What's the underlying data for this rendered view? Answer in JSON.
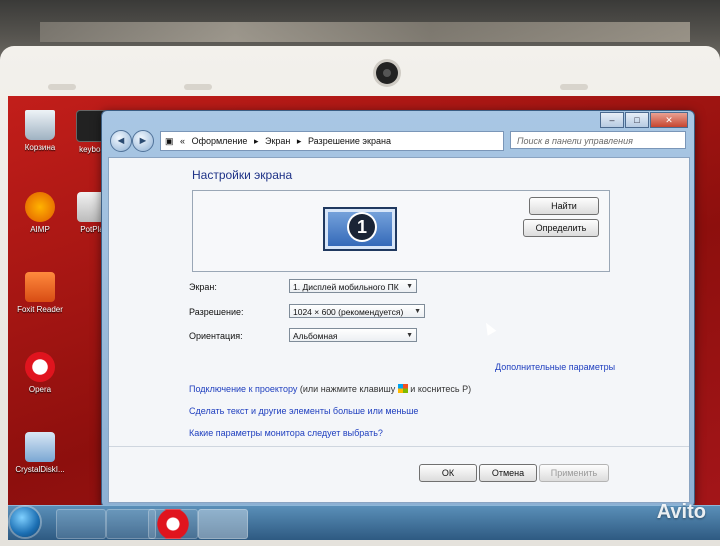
{
  "desktop": {
    "icons": [
      {
        "label": "Корзина",
        "icon": "recycle-bin-icon"
      },
      {
        "label": "keyboa",
        "icon": "keyboard-icon"
      },
      {
        "label": "AIMP",
        "icon": "aimp-icon"
      },
      {
        "label": "PotPla",
        "icon": "potplayer-icon"
      },
      {
        "label": "Foxit Reader",
        "icon": "pdf-icon"
      },
      {
        "label": "Opera",
        "icon": "opera-icon"
      },
      {
        "label": "CrystalDiskI...",
        "icon": "crystaldisk-icon"
      }
    ]
  },
  "window": {
    "controls": {
      "minimize": "–",
      "maximize": "□",
      "close": "✕"
    },
    "nav": {
      "back": "◄",
      "forward": "►"
    },
    "breadcrumb": [
      "«",
      "Оформление",
      "Экран",
      "Разрешение экрана"
    ],
    "search_placeholder": "Поиск в панели управления",
    "title": "Настройки экрана",
    "monitor_number": "1",
    "detect_button": "Найти",
    "identify_button": "Определить",
    "fields": {
      "screen_label": "Экран:",
      "screen_value": "1. Дисплей мобильного ПК",
      "resolution_label": "Разрешение:",
      "resolution_value": "1024 × 600 (рекомендуется)",
      "orientation_label": "Ориентация:",
      "orientation_value": "Альбомная"
    },
    "advanced_link": "Дополнительные параметры",
    "projector_link": "Подключение к проектору",
    "projector_hint_before": "(или нажмите клавишу",
    "projector_hint_after": "и коснитесь P)",
    "text_size_link": "Сделать текст и другие элементы больше или меньше",
    "which_settings_link": "Какие параметры монитора следует выбрать?",
    "ok_button": "ОК",
    "cancel_button": "Отмена",
    "apply_button": "Применить"
  },
  "watermark": "Avito"
}
